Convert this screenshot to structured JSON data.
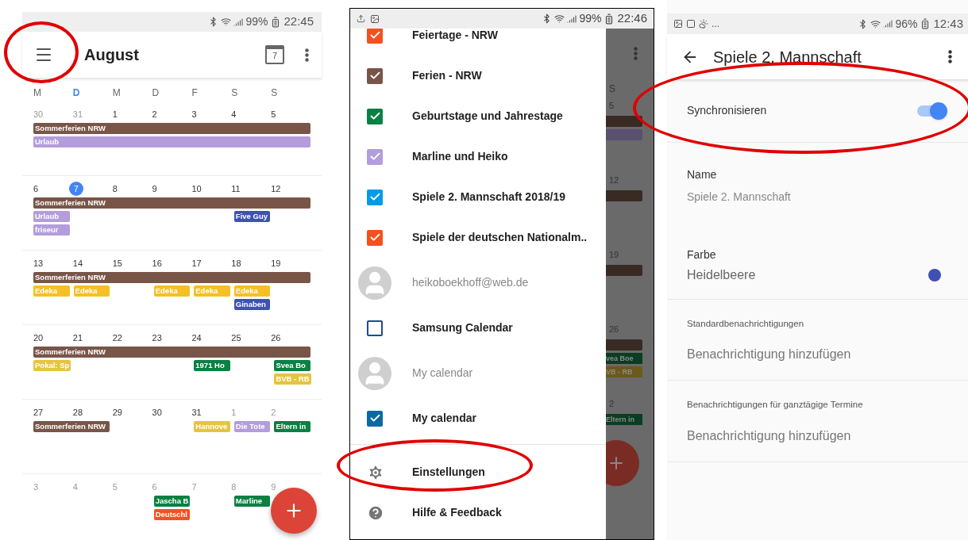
{
  "calendar_screen": {
    "status_bar": {
      "battery": "99%",
      "time": "22:45"
    },
    "top_bar": {
      "menu_circled": true,
      "title": "August",
      "today_icon_day": "7"
    },
    "weekdays": [
      {
        "label": "M",
        "today": false
      },
      {
        "label": "D",
        "today": true
      },
      {
        "label": "M",
        "today": false
      },
      {
        "label": "D",
        "today": false
      },
      {
        "label": "F",
        "today": false
      },
      {
        "label": "S",
        "today": false
      },
      {
        "label": "S",
        "today": false
      }
    ],
    "weeks": [
      {
        "days": [
          {
            "label": "30",
            "dim": true,
            "today": false
          },
          {
            "label": "31",
            "dim": true,
            "today": false
          },
          {
            "label": "1",
            "dim": false,
            "today": false
          },
          {
            "label": "2",
            "dim": false,
            "today": false
          },
          {
            "label": "3",
            "dim": false,
            "today": false
          },
          {
            "label": "4",
            "dim": false,
            "today": false
          },
          {
            "label": "5",
            "dim": false,
            "today": false
          }
        ],
        "lines": [
          [
            {
              "kind": "event",
              "title": "Sommerferien NRW",
              "color": "#795548"
            },
            {
              "kind": "more"
            },
            {
              "kind": "more"
            },
            {
              "kind": "more"
            },
            {
              "kind": "more"
            },
            {
              "kind": "more"
            },
            {
              "kind": "more"
            }
          ],
          [
            {
              "kind": "event",
              "title": "Urlaub",
              "color": "#b39ddb"
            },
            {
              "kind": "more"
            },
            {
              "kind": "more"
            },
            {
              "kind": "more"
            },
            {
              "kind": "more"
            },
            {
              "kind": "more"
            },
            {
              "kind": "more"
            }
          ]
        ]
      },
      {
        "days": [
          {
            "label": "6",
            "dim": false,
            "today": false
          },
          {
            "label": "7",
            "dim": false,
            "today": true
          },
          {
            "label": "8",
            "dim": false,
            "today": false
          },
          {
            "label": "9",
            "dim": false,
            "today": false
          },
          {
            "label": "10",
            "dim": false,
            "today": false
          },
          {
            "label": "11",
            "dim": false,
            "today": false
          },
          {
            "label": "12",
            "dim": false,
            "today": false
          }
        ],
        "lines": [
          [
            {
              "kind": "event",
              "title": "Sommerferien NRW",
              "color": "#795548"
            },
            {
              "kind": "more"
            },
            {
              "kind": "more"
            },
            {
              "kind": "more"
            },
            {
              "kind": "more"
            },
            {
              "kind": "more"
            },
            {
              "kind": "more"
            }
          ],
          [
            {
              "kind": "event",
              "title": "Urlaub",
              "color": "#b39ddb"
            },
            {
              "kind": "empty"
            },
            {
              "kind": "empty"
            },
            {
              "kind": "empty"
            },
            {
              "kind": "empty"
            },
            {
              "kind": "event",
              "title": "Five Guy",
              "color": "#3f51b5"
            },
            {
              "kind": "empty"
            }
          ],
          [
            {
              "kind": "event",
              "title": "friseur",
              "color": "#b39ddb"
            },
            {
              "kind": "empty"
            },
            {
              "kind": "empty"
            },
            {
              "kind": "empty"
            },
            {
              "kind": "empty"
            },
            {
              "kind": "empty"
            },
            {
              "kind": "empty"
            }
          ]
        ]
      },
      {
        "days": [
          {
            "label": "13",
            "dim": false,
            "today": false
          },
          {
            "label": "14",
            "dim": false,
            "today": false
          },
          {
            "label": "15",
            "dim": false,
            "today": false
          },
          {
            "label": "16",
            "dim": false,
            "today": false
          },
          {
            "label": "17",
            "dim": false,
            "today": false
          },
          {
            "label": "18",
            "dim": false,
            "today": false
          },
          {
            "label": "19",
            "dim": false,
            "today": false
          }
        ],
        "lines": [
          [
            {
              "kind": "event",
              "title": "Sommerferien NRW",
              "color": "#795548"
            },
            {
              "kind": "more"
            },
            {
              "kind": "more"
            },
            {
              "kind": "more"
            },
            {
              "kind": "more"
            },
            {
              "kind": "more"
            },
            {
              "kind": "more"
            }
          ],
          [
            {
              "kind": "event",
              "title": "Edeka",
              "color": "#f6bf26"
            },
            {
              "kind": "event",
              "title": "Edeka",
              "color": "#f6bf26"
            },
            {
              "kind": "empty"
            },
            {
              "kind": "event",
              "title": "Edeka",
              "color": "#f6bf26"
            },
            {
              "kind": "event",
              "title": "Edeka",
              "color": "#f6bf26"
            },
            {
              "kind": "event",
              "title": "Edeka",
              "color": "#f6bf26"
            },
            {
              "kind": "empty"
            }
          ],
          [
            {
              "kind": "empty"
            },
            {
              "kind": "empty"
            },
            {
              "kind": "empty"
            },
            {
              "kind": "empty"
            },
            {
              "kind": "empty"
            },
            {
              "kind": "event",
              "title": "Ginaben",
              "color": "#3f51b5"
            },
            {
              "kind": "empty"
            }
          ]
        ]
      },
      {
        "days": [
          {
            "label": "20",
            "dim": false,
            "today": false
          },
          {
            "label": "21",
            "dim": false,
            "today": false
          },
          {
            "label": "22",
            "dim": false,
            "today": false
          },
          {
            "label": "23",
            "dim": false,
            "today": false
          },
          {
            "label": "24",
            "dim": false,
            "today": false
          },
          {
            "label": "25",
            "dim": false,
            "today": false
          },
          {
            "label": "26",
            "dim": false,
            "today": false
          }
        ],
        "lines": [
          [
            {
              "kind": "event",
              "title": "Sommerferien NRW",
              "color": "#795548"
            },
            {
              "kind": "more"
            },
            {
              "kind": "more"
            },
            {
              "kind": "more"
            },
            {
              "kind": "more"
            },
            {
              "kind": "more"
            },
            {
              "kind": "more"
            }
          ],
          [
            {
              "kind": "event",
              "title": "Pokal: Sp",
              "color": "#e4c441"
            },
            {
              "kind": "empty"
            },
            {
              "kind": "empty"
            },
            {
              "kind": "empty"
            },
            {
              "kind": "event",
              "title": "1971 Ho",
              "color": "#0b8043"
            },
            {
              "kind": "empty"
            },
            {
              "kind": "event",
              "title": "Svea Bo",
              "color": "#0b8043"
            }
          ],
          [
            {
              "kind": "empty"
            },
            {
              "kind": "empty"
            },
            {
              "kind": "empty"
            },
            {
              "kind": "empty"
            },
            {
              "kind": "empty"
            },
            {
              "kind": "empty"
            },
            {
              "kind": "event",
              "title": "BVB - RB",
              "color": "#e4c441"
            }
          ]
        ]
      },
      {
        "days": [
          {
            "label": "27",
            "dim": false,
            "today": false
          },
          {
            "label": "28",
            "dim": false,
            "today": false
          },
          {
            "label": "29",
            "dim": false,
            "today": false
          },
          {
            "label": "30",
            "dim": false,
            "today": false
          },
          {
            "label": "31",
            "dim": false,
            "today": false
          },
          {
            "label": "1",
            "dim": true,
            "today": false
          },
          {
            "label": "2",
            "dim": true,
            "today": false
          }
        ],
        "lines": [
          [
            {
              "kind": "event",
              "title": "Sommerferien NRW",
              "color": "#795548"
            },
            {
              "kind": "more"
            },
            {
              "kind": "empty"
            },
            {
              "kind": "empty"
            },
            {
              "kind": "event",
              "title": "Hannove",
              "color": "#e4c441"
            },
            {
              "kind": "event",
              "title": "Die Tote",
              "color": "#b39ddb"
            },
            {
              "kind": "event",
              "title": "Eltern in",
              "color": "#0b8043"
            }
          ]
        ]
      },
      {
        "days": [
          {
            "label": "3",
            "dim": true,
            "today": false
          },
          {
            "label": "4",
            "dim": true,
            "today": false
          },
          {
            "label": "5",
            "dim": true,
            "today": false
          },
          {
            "label": "6",
            "dim": true,
            "today": false
          },
          {
            "label": "7",
            "dim": true,
            "today": false
          },
          {
            "label": "8",
            "dim": true,
            "today": false
          },
          {
            "label": "9",
            "dim": true,
            "today": false
          }
        ],
        "lines": [
          [
            {
              "kind": "empty"
            },
            {
              "kind": "empty"
            },
            {
              "kind": "empty"
            },
            {
              "kind": "event",
              "title": "Jascha B",
              "color": "#0b8043"
            },
            {
              "kind": "empty"
            },
            {
              "kind": "event",
              "title": "Marline",
              "color": "#0b8043"
            },
            {
              "kind": "empty"
            }
          ],
          [
            {
              "kind": "empty"
            },
            {
              "kind": "empty"
            },
            {
              "kind": "empty"
            },
            {
              "kind": "event",
              "title": "Deutschl",
              "color": "#f4511e"
            },
            {
              "kind": "empty"
            },
            {
              "kind": "empty"
            },
            {
              "kind": "empty"
            }
          ]
        ]
      }
    ]
  },
  "drawer_screen": {
    "status_bar": {
      "battery": "99%",
      "time": "22:46"
    },
    "items": [
      {
        "kind": "calendar",
        "label": "Feiertage - NRW",
        "color": "#f4511e",
        "checked": true,
        "circled": false
      },
      {
        "kind": "calendar",
        "label": "Ferien - NRW",
        "color": "#795548",
        "checked": true,
        "circled": false
      },
      {
        "kind": "calendar",
        "label": "Geburtstage und Jahrestage",
        "color": "#0b8043",
        "checked": true,
        "circled": false
      },
      {
        "kind": "calendar",
        "label": "Marline und Heiko",
        "color": "#b39ddb",
        "checked": true,
        "circled": false
      },
      {
        "kind": "calendar",
        "label": "Spiele 2. Mannschaft 2018/19",
        "color": "#039be5",
        "checked": true,
        "circled": false
      },
      {
        "kind": "calendar",
        "label": "Spiele der deutschen Nationalm..",
        "color": "#f4511e",
        "checked": true,
        "circled": false
      },
      {
        "kind": "account",
        "label": "heikoboekhoff@web.de",
        "circled": false
      },
      {
        "kind": "calendar",
        "label": "Samsung Calendar",
        "color": "#1e4b8f",
        "checked": false,
        "circled": false
      },
      {
        "kind": "account",
        "label": "My calendar",
        "circled": false
      },
      {
        "kind": "calendar",
        "label": "My calendar",
        "color": "#0a6aa1",
        "checked": true,
        "circled": false
      },
      {
        "kind": "settings",
        "label": "Einstellungen",
        "circled": true
      },
      {
        "kind": "help",
        "label": "Hilfe & Feedback",
        "circled": false
      }
    ],
    "behind": {
      "weekday": "S",
      "weeks": [
        {
          "day": "5",
          "items": [
            {
              "kind": "bar",
              "color": "#3a2a24"
            },
            {
              "kind": "bar",
              "color": "#5a5070"
            }
          ]
        },
        {
          "day": "12",
          "items": [
            {
              "kind": "bar",
              "color": "#3a2a24"
            }
          ]
        },
        {
          "day": "19",
          "items": [
            {
              "kind": "bar",
              "color": "#3a2a24"
            }
          ]
        },
        {
          "day": "26",
          "items": [
            {
              "kind": "bar",
              "color": "#3a2a24"
            },
            {
              "kind": "chip",
              "color": "#0a3d22",
              "title": "vea Boe"
            },
            {
              "kind": "chip",
              "color": "#6b5a1a",
              "title": "VB - RB"
            }
          ]
        },
        {
          "day": "2",
          "items": [
            {
              "kind": "chip",
              "color": "#0a3d22",
              "title": "Eltern in"
            }
          ]
        }
      ]
    }
  },
  "settings_screen": {
    "status_bar": {
      "notification_more": "...",
      "battery": "96%",
      "time": "12:43"
    },
    "title": "Spiele 2. Mannschaft",
    "sync": {
      "label": "Synchronisieren",
      "on": true,
      "circled": true
    },
    "name": {
      "label": "Name",
      "value": "Spiele 2. Mannschaft"
    },
    "color": {
      "label": "Farbe",
      "value": "Heidelbeere",
      "color": "#3f51b5"
    },
    "notification_sections": [
      {
        "label": "Standardbenachrichtigungen",
        "action": "Benachrichtigung hinzufügen"
      },
      {
        "label": "Benachrichtigungen für ganztägige Termine",
        "action": "Benachrichtigung hinzufügen"
      }
    ]
  }
}
